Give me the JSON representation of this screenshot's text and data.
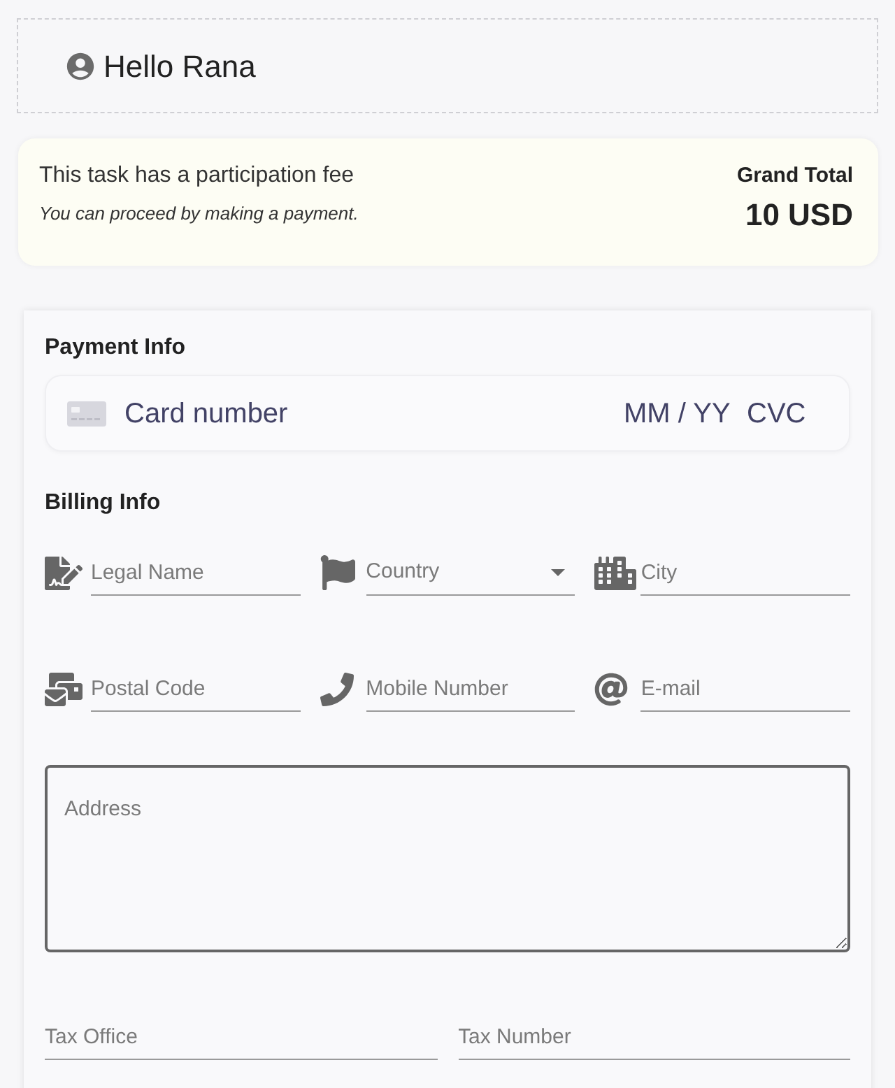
{
  "greeting": {
    "text": "Hello Rana"
  },
  "fee_notice": {
    "title": "This task has a participation fee",
    "subtitle": "You can proceed by making a payment.",
    "total_label": "Grand Total",
    "total_value": "10 USD"
  },
  "payment_info": {
    "heading": "Payment Info",
    "card_field": {
      "number_placeholder": "Card number",
      "expiry_placeholder": "MM / YY",
      "cvc_placeholder": "CVC"
    }
  },
  "billing_info": {
    "heading": "Billing Info",
    "fields": [
      {
        "kind": "text",
        "placeholder": "Legal Name"
      },
      {
        "kind": "select",
        "placeholder": "Country"
      },
      {
        "kind": "text",
        "placeholder": "City"
      },
      {
        "kind": "text",
        "placeholder": "Postal Code"
      },
      {
        "kind": "text",
        "placeholder": "Mobile Number"
      },
      {
        "kind": "text",
        "placeholder": "E-mail"
      }
    ],
    "address": {
      "placeholder": "Address"
    },
    "tax_fields": [
      {
        "placeholder": "Tax Office"
      },
      {
        "placeholder": "Tax Number"
      }
    ]
  }
}
